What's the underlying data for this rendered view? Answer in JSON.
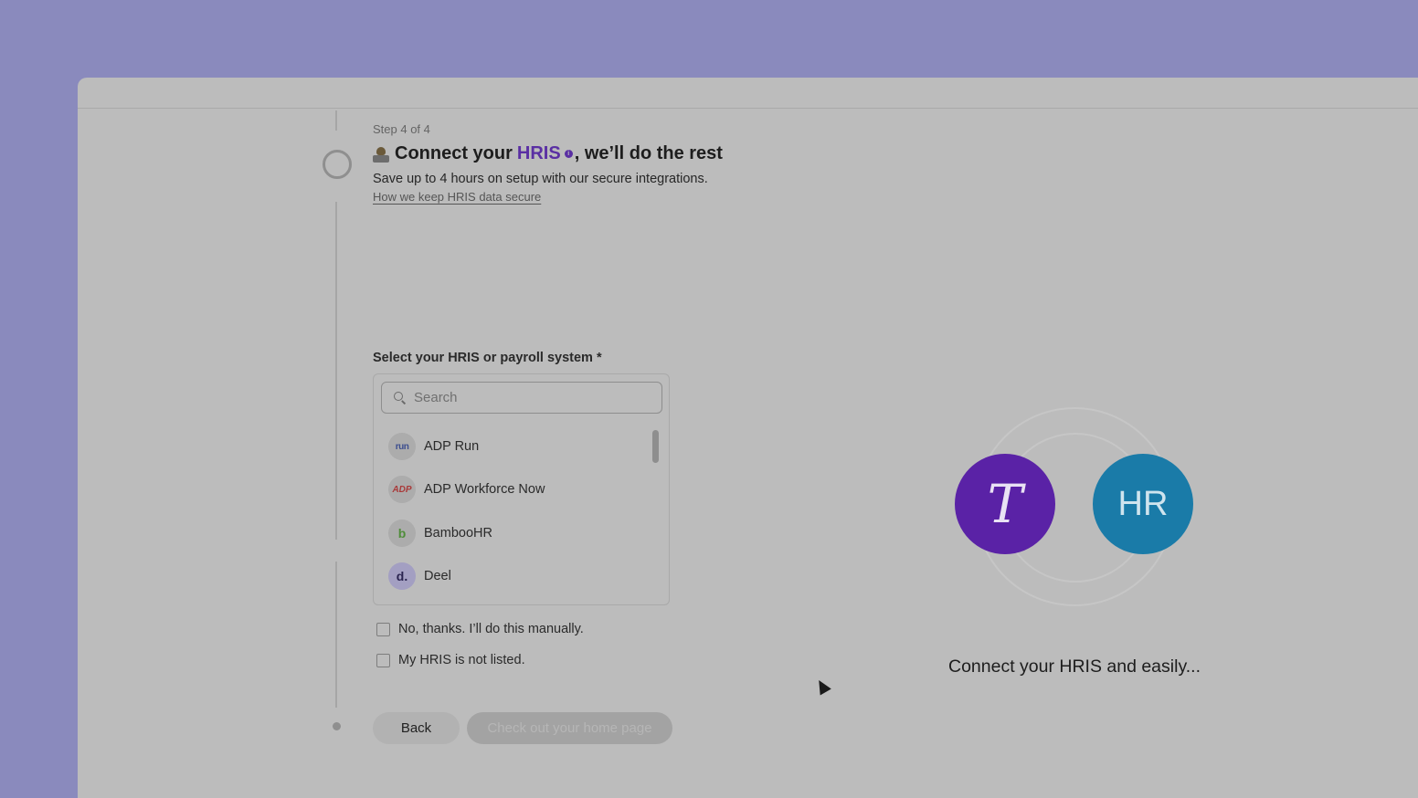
{
  "step": {
    "label": "Step 4 of 4"
  },
  "header": {
    "title_prefix": "Connect your",
    "title_highlight": "HRIS",
    "title_suffix": ", we’ll do the rest",
    "subtitle": "Save up to 4 hours on setup with our secure integrations.",
    "secure_link": "How we keep HRIS data secure",
    "info_glyph": "i"
  },
  "hris_select": {
    "label": "Select your HRIS or payroll system *",
    "search_placeholder": "Search",
    "options": [
      {
        "name": "ADP Run",
        "logo_text": "run"
      },
      {
        "name": "ADP Workforce Now",
        "logo_text": "ADP"
      },
      {
        "name": "BambooHR",
        "logo_text": "b"
      },
      {
        "name": "Deel",
        "logo_text": "d."
      }
    ]
  },
  "checkboxes": {
    "manual": "No, thanks. I’ll do this manually.",
    "not_listed": "My HRIS is not listed."
  },
  "buttons": {
    "back": "Back",
    "primary": "Check out your home page"
  },
  "panel": {
    "t_glyph": "T",
    "hr_label": "HR",
    "caption": "Connect your HRIS and easily..."
  },
  "colors": {
    "accent_purple": "#5a2fa3",
    "hr_blue": "#1a7ba8",
    "backdrop": "#8a8abd"
  }
}
